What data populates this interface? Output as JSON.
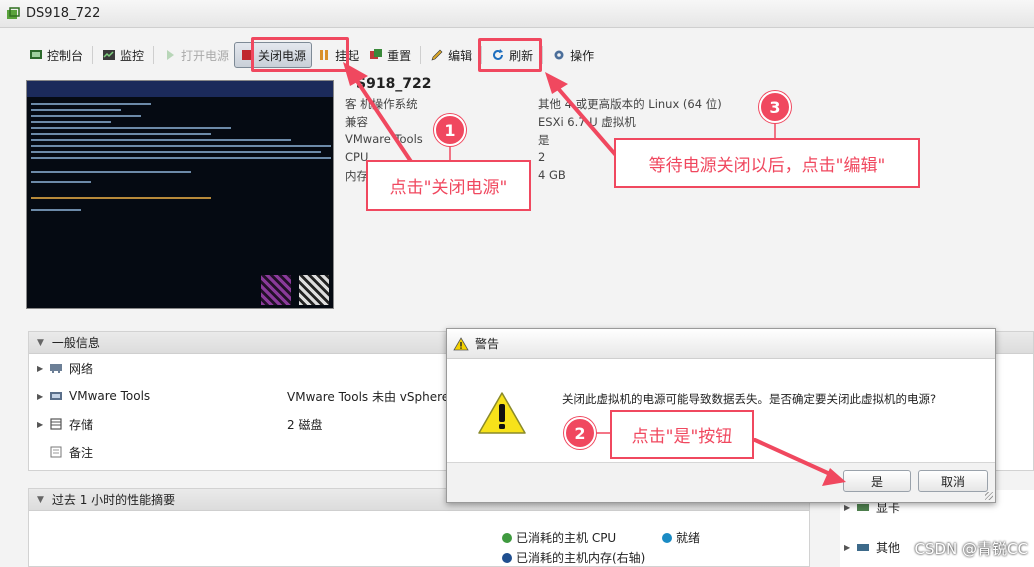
{
  "window": {
    "title": "DS918_722"
  },
  "toolbar": {
    "console": "控制台",
    "monitor": "监控",
    "power_on": "打开电源",
    "power_off": "关闭电源",
    "suspend": "挂起",
    "reset": "重置",
    "edit": "编辑",
    "refresh": "刷新",
    "actions": "操作"
  },
  "summary": {
    "name": "S918_722",
    "rows": [
      {
        "label": "客 机操作系统",
        "value": "其他 4    或更高版本的 Linux (64 位)"
      },
      {
        "label": "兼容",
        "value": "ESXi 6.7 U     虚拟机"
      },
      {
        "label": "VMware Tools",
        "value": "是"
      },
      {
        "label": "CPU",
        "value": "2"
      },
      {
        "label": "内存",
        "value": "4 GB"
      }
    ]
  },
  "general_panel": {
    "title": "一般信息",
    "rows": [
      {
        "label": "网络",
        "value": ""
      },
      {
        "label": "VMware Tools",
        "value": "VMware Tools 未由 vSphere"
      },
      {
        "label": "存储",
        "value": "2 磁盘"
      },
      {
        "label": "备注",
        "value": ""
      }
    ]
  },
  "perf_panel": {
    "title": "过去 1 小时的性能摘要",
    "legend": [
      {
        "label": "已消耗的主机 CPU",
        "color": "#3f9a3f"
      },
      {
        "label": "就绪",
        "color": "#1a8bc4"
      },
      {
        "label": "已消耗的主机内存(右轴)",
        "color": "#1f4f8f"
      }
    ]
  },
  "hardware_peek": {
    "items": [
      {
        "label": "显卡"
      },
      {
        "label": "其他"
      }
    ]
  },
  "dialog": {
    "title": "警告",
    "message": "关闭此虚拟机的电源可能导致数据丢失。是否确定要关闭此虚拟机的电源?",
    "yes": "是",
    "cancel": "取消"
  },
  "annotations": {
    "step1": {
      "number": "1",
      "text": "点击\"关闭电源\""
    },
    "step2": {
      "number": "2",
      "text": "点击\"是\"按钮"
    },
    "step3": {
      "number": "3",
      "text": "等待电源关闭以后，点击\"编辑\""
    },
    "color": "#f0485f"
  },
  "watermark": "CSDN @青锐CC"
}
